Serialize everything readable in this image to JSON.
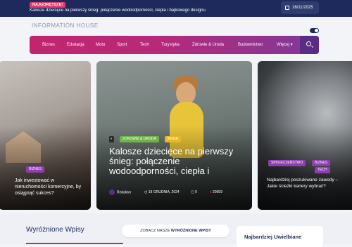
{
  "topbar": {
    "hot_badge": "NAJGORĘTSZE!",
    "hot_headline": "Kalosze dziecięce na pierwszy śnieg: połączenie wodoodporności, ciepła i bajkowego designu",
    "date": "16/11/2025"
  },
  "logo": "INFORMATION HOUSE",
  "nav": {
    "items": [
      "Biznes",
      "Edukacja",
      "Moto",
      "Sport",
      "Tech",
      "Turystyka",
      "Zdrowie & Uroda",
      "Budownictwo",
      "Więcej"
    ],
    "search_icon": "search-icon",
    "colors": [
      "#c2256f",
      "#7d3a9c"
    ]
  },
  "cards": {
    "left": {
      "tag": "BIZNES",
      "title": "Jak inwestować w nieruchomości komercyjne, by osiągnąć sukces?"
    },
    "center": {
      "tags": [
        "ZDROWIE & URODA",
        "MODA"
      ],
      "title": "Kalosze dziecięce na pierwszy śnieg: połączenie wodoodporności, ciepła i",
      "author": "Redaktor",
      "date": "19 GRUDNIA, 2024",
      "comments": "0",
      "views": "20959"
    },
    "right": {
      "tags": [
        "SPOŁECZEŃSTWO",
        "BIZNES",
        "TECH"
      ],
      "title": "Najbardziej poszukiwane zawody – Jakie ścieżki kariery wybrać?"
    }
  },
  "bottom": {
    "section_title": "Wyróżnione Wpisy",
    "see_all_prefix": "ZOBACZ NASZE",
    "see_all_strong": "WYRÓŻNIONE WPISY",
    "side_title": "Najbardziej Uwielbiane"
  }
}
